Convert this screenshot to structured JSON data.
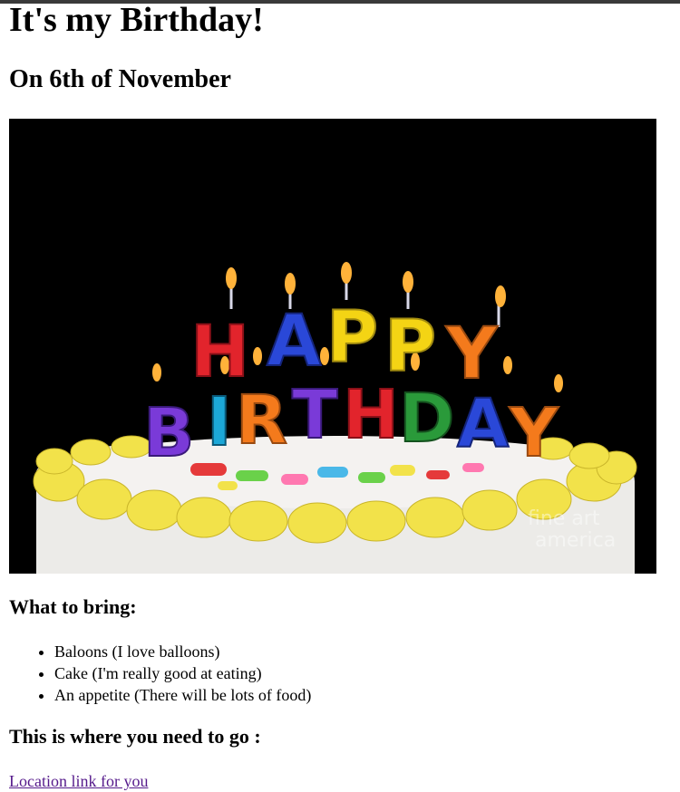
{
  "header": {
    "title": "It's my Birthday!",
    "date_line": "On 6th of November"
  },
  "image": {
    "alt": "HAPPY BIRTHDAY candles on a cake",
    "candle_text_top": "HAPPY",
    "candle_text_bottom": "BIRTHDAY",
    "watermark": "fine art america"
  },
  "bring": {
    "heading": "What to bring:",
    "items": [
      "Baloons (I love balloons)",
      "Cake (I'm really good at eating)",
      "An appetite (There will be lots of food)"
    ]
  },
  "location": {
    "heading": "This is where you need to go :",
    "link_text": "Location link for you"
  },
  "colors": {
    "link_visited": "#551a8b",
    "photo_background": "#000000",
    "frosting": "#f2e24a"
  }
}
